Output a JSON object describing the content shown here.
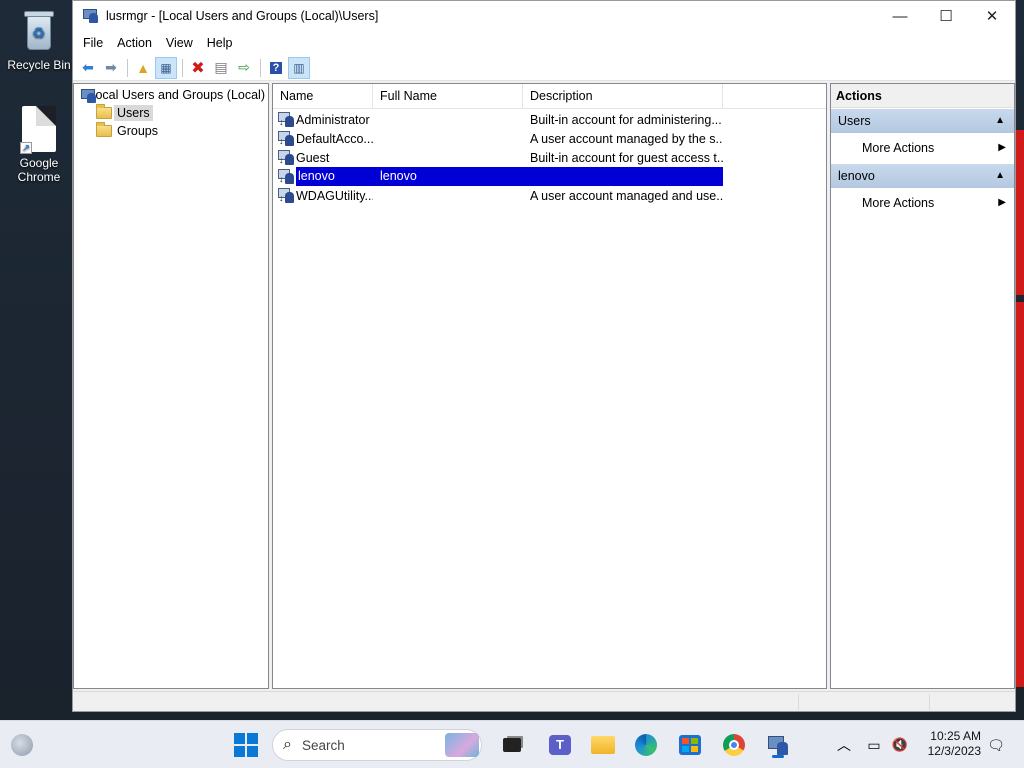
{
  "desktop": {
    "icons": [
      {
        "label": "Recycle Bin",
        "icon": "recycle-bin-icon"
      },
      {
        "label": "Google Chrome",
        "icon": "file-shortcut-icon"
      }
    ]
  },
  "window": {
    "title": "lusrmgr - [Local Users and Groups (Local)\\Users]",
    "controls": {
      "minimize": "—",
      "maximize": "☐",
      "close": "✕"
    }
  },
  "menu": {
    "file": "File",
    "action": "Action",
    "view": "View",
    "help": "Help"
  },
  "tree": {
    "root": "Local Users and Groups (Local)",
    "users": "Users",
    "groups": "Groups"
  },
  "list": {
    "columns": {
      "name": "Name",
      "full_name": "Full Name",
      "description": "Description"
    },
    "rows": [
      {
        "name": "Administrator",
        "full_name": "",
        "description": "Built-in account for administering..."
      },
      {
        "name": "DefaultAcco...",
        "full_name": "",
        "description": "A user account managed by the s..."
      },
      {
        "name": "Guest",
        "full_name": "",
        "description": "Built-in account for guest access t..."
      },
      {
        "name": "lenovo",
        "full_name": "lenovo",
        "description": ""
      },
      {
        "name": "WDAGUtility...",
        "full_name": "",
        "description": "A user account managed and use..."
      }
    ],
    "selected_row": "lenovo"
  },
  "actions": {
    "header": "Actions",
    "sections": [
      {
        "title": "Users",
        "item": "More Actions"
      },
      {
        "title": "lenovo",
        "item": "More Actions"
      }
    ]
  },
  "taskbar": {
    "search_placeholder": "Search",
    "time": "10:25 AM",
    "date": "12/3/2023"
  },
  "colors": {
    "selection": "#0000d6",
    "action_section": "#b9cde4",
    "taskbar": "#e9edf3",
    "accent": "#0a78d7"
  }
}
